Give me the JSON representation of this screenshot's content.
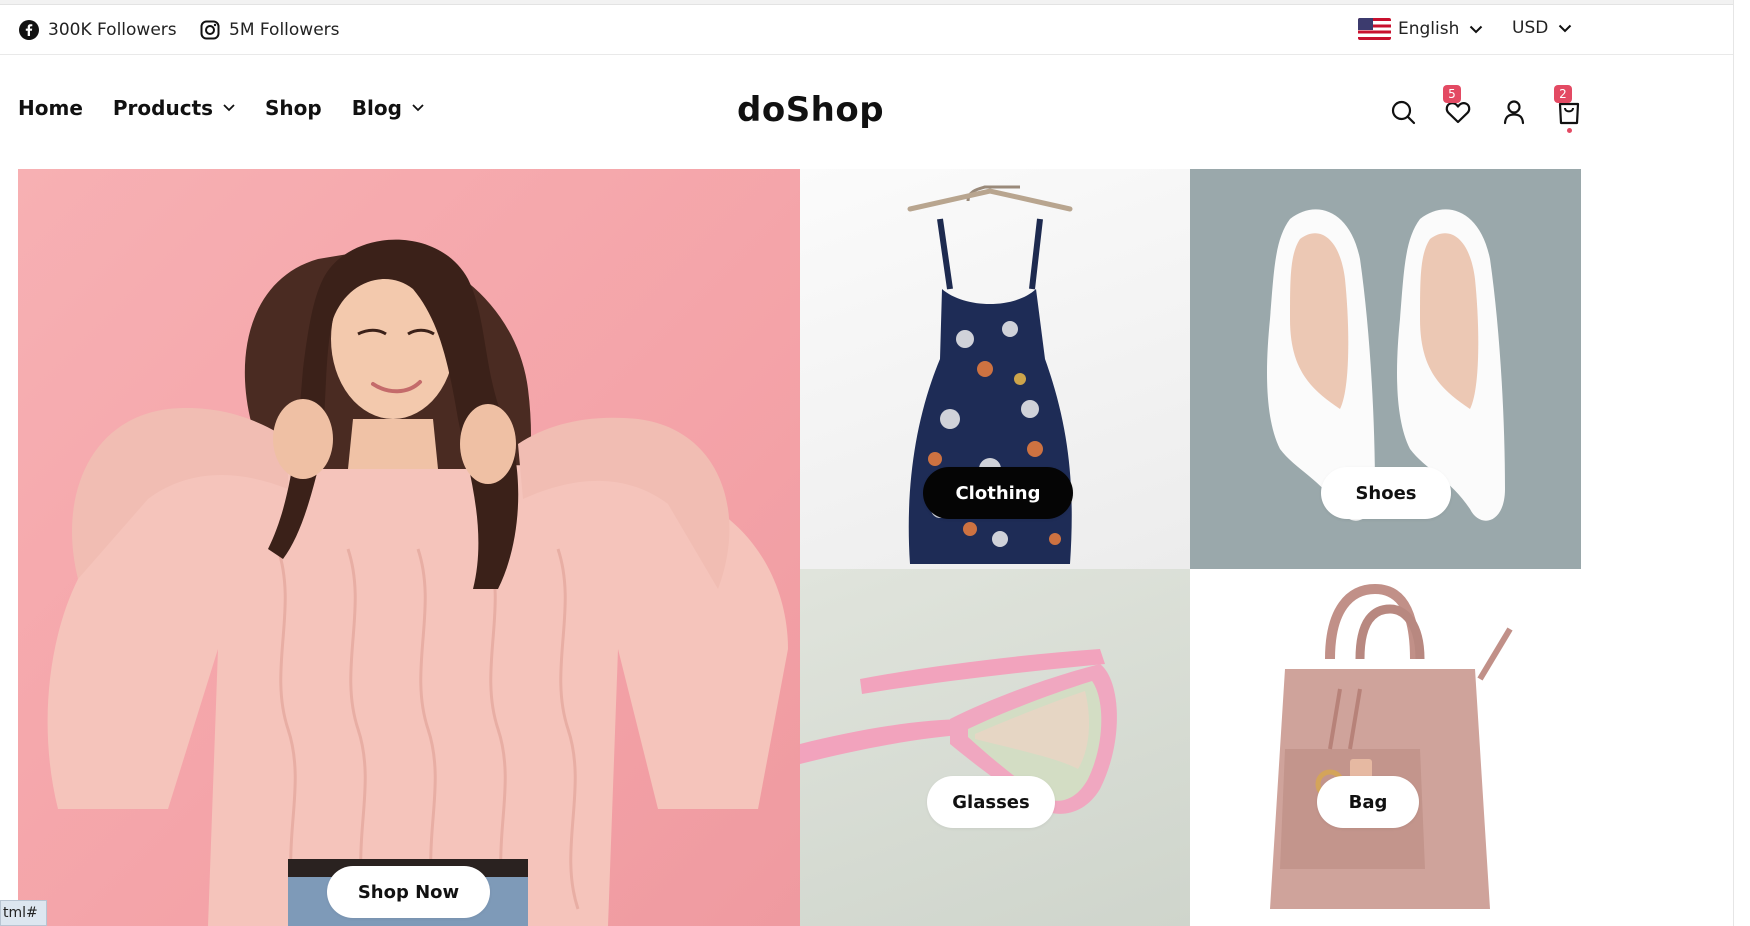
{
  "topbar": {
    "facebook": {
      "icon": "facebook-icon",
      "label": "300K Followers"
    },
    "instagram": {
      "icon": "instagram-icon",
      "label": "5M Followers"
    },
    "language": {
      "icon": "us-flag-icon",
      "label": "English"
    },
    "currency": {
      "label": "USD"
    }
  },
  "nav": {
    "items": [
      {
        "label": "Home",
        "has_dropdown": false
      },
      {
        "label": "Products",
        "has_dropdown": true
      },
      {
        "label": "Shop",
        "has_dropdown": false
      },
      {
        "label": "Blog",
        "has_dropdown": true
      }
    ]
  },
  "brand": {
    "logo": "doShop"
  },
  "header_icons": {
    "search": {
      "icon": "search-icon"
    },
    "wishlist": {
      "icon": "heart-icon",
      "count": "5"
    },
    "account": {
      "icon": "user-icon"
    },
    "cart": {
      "icon": "shopping-bag-icon",
      "count": "2"
    }
  },
  "banner": {
    "main": {
      "cta": "Shop Now",
      "image": "woman in pink knit sweater"
    },
    "clothing": {
      "label": "Clothing",
      "image": "floral sundress on hanger"
    },
    "shoes": {
      "label": "Shoes",
      "image": "white pointed heels"
    },
    "glasses": {
      "label": "Glasses",
      "image": "pink sunglasses"
    },
    "bag": {
      "label": "Bag",
      "image": "pink leather handbag"
    }
  },
  "statusbar": {
    "text": "tml#"
  },
  "colors": {
    "accent": "#e34a63",
    "hero_pink": "#f4a3a8",
    "shoes_bg": "#9aa8ab",
    "dark_pill": "#050505"
  }
}
